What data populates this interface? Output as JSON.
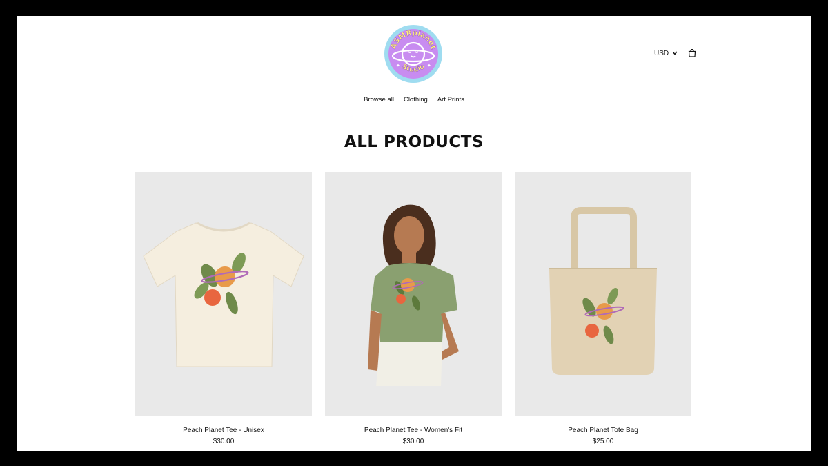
{
  "store": {
    "logo_text_top": "ASMRplanet",
    "logo_text_bottom": "Studio"
  },
  "header": {
    "currency": "USD"
  },
  "icons": {
    "currency_dropdown": "chevron-down-icon",
    "cart": "shopping-bag-icon"
  },
  "nav": {
    "items": [
      {
        "label": "Browse all"
      },
      {
        "label": "Clothing"
      },
      {
        "label": "Art Prints"
      }
    ]
  },
  "page": {
    "title": "ALL PRODUCTS"
  },
  "products": [
    {
      "name": "Peach Planet Tee - Unisex",
      "price": "$30.00"
    },
    {
      "name": "Peach Planet Tee - Women's Fit",
      "price": "$30.00"
    },
    {
      "name": "Peach Planet Tote Bag",
      "price": "$25.00"
    }
  ],
  "colors": {
    "logo_ring": "#9fdcf0",
    "logo_fill": "#c88cf0",
    "logo_text": "#fff27a",
    "card_bg": "#e9e9e9",
    "peach": "#e8663f",
    "leaf": "#6f8a4a"
  }
}
